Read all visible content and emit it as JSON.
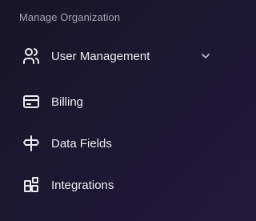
{
  "section": {
    "title": "Manage Organization"
  },
  "nav": {
    "items": [
      {
        "label": "User Management",
        "icon": "users-icon",
        "expandable": true
      },
      {
        "label": "Billing",
        "icon": "credit-card-icon",
        "expandable": false
      },
      {
        "label": "Data Fields",
        "icon": "signpost-icon",
        "expandable": false
      },
      {
        "label": "Integrations",
        "icon": "blocks-icon",
        "expandable": false
      }
    ]
  },
  "colors": {
    "background": "#1a1829",
    "text": "#ecebf3",
    "muted": "#a6a5b3"
  }
}
